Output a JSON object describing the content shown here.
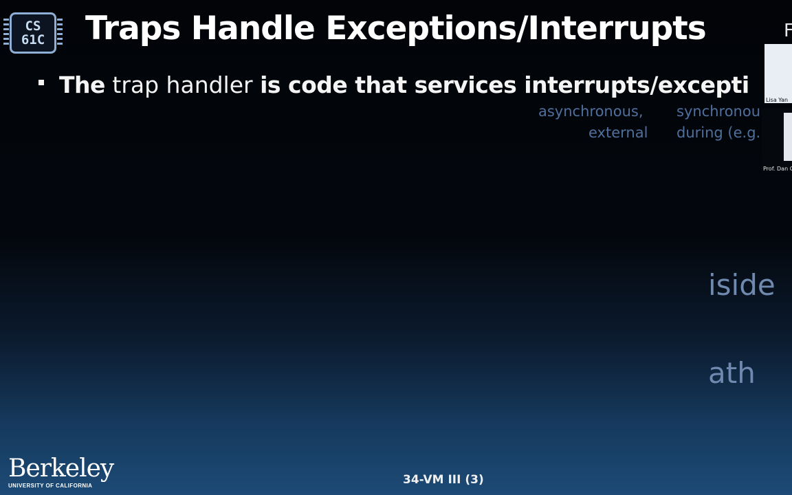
{
  "logo": {
    "line1": "CS",
    "line2": "61C"
  },
  "slide": {
    "title": "Traps Handle Exceptions/Interrupts"
  },
  "bullet": {
    "part1": "The",
    "part2": "trap handler",
    "part3": "is code that services interrupts/excepti"
  },
  "overlay": {
    "col1_line1": "asynchronous,",
    "col1_line2": "external",
    "col2_line1": "synchronou",
    "col2_line2": "during (e.g.",
    "fragment1": "iside",
    "fragment2": "ath",
    "edge_letter": "F"
  },
  "participants": {
    "tile1_name": "Lisa Yan",
    "tile2_name": "Prof. Dan G"
  },
  "footer": {
    "brand": "Berkeley",
    "brand_sub": "UNIVERSITY OF CALIFORNIA",
    "slide_number": "34-VM III (3)"
  }
}
